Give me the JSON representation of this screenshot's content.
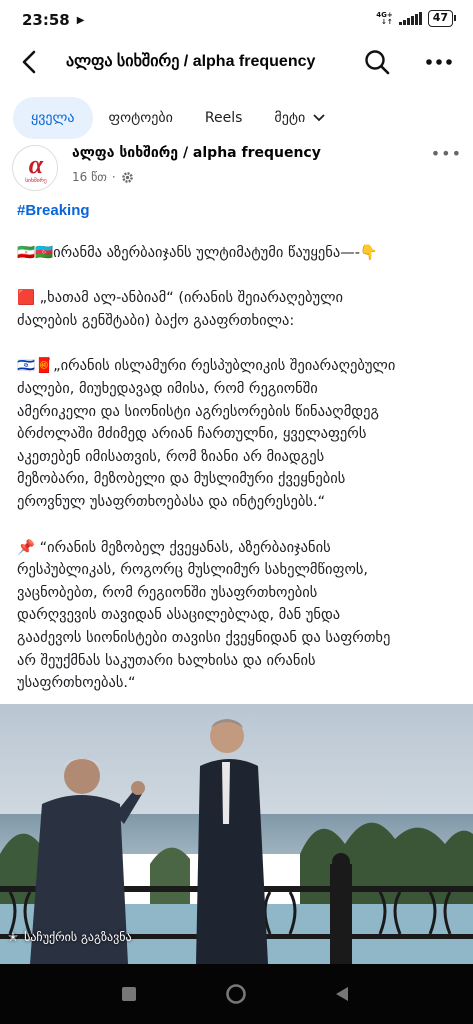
{
  "status_bar": {
    "time": "23:58",
    "network_top": "4G+",
    "network_bottom": "↓↑",
    "battery": "47"
  },
  "header": {
    "title": "ალფა სიხშირე / alpha frequency"
  },
  "tabs": [
    {
      "label": "ყველა"
    },
    {
      "label": "ფოტოები"
    },
    {
      "label": "Reels"
    },
    {
      "label": "მეტი"
    }
  ],
  "post": {
    "page_name": "ალფა სიხშირე / alpha frequency",
    "time": "16 წთ",
    "avatar_text": "სიხშირე",
    "hashtag": "#Breaking",
    "paragraphs": [
      "🇮🇷🇦🇿ირანმა აზერბაიჯანს ულტიმატუმი წაუყენა—-👇",
      "🟥 „ხათამ ალ-ანბიამ“ (ირანის შეიარაღებული\nძალების გენშტაბი) ბაქო გააფრთხილა:",
      "🇮🇱🧧„ირანის ისლამური რესპუბლიკის შეიარაღებული\nძალები, მიუხედავად იმისა, რომ რეგიონში\nამერიკელი და სიონისტი აგრესორების წინააღმდეგ\nბრძოლაში მძიმედ არიან ჩართულნი, ყველაფერს\nაკეთებენ იმისათვის, რომ ზიანი არ მიადგეს\nმეზობარი, მეზობელი და მუსლიმური ქვეყნების\nეროვნულ უსაფრთხოებასა და ინტერესებს.“",
      "📌 “ირანის მეზობელ ქვეყანას, აზერბაიჯანის\nრესპუბლიკას, როგორც მუსლიმურ სახელმწიფოს,\nვაცნობებთ, რომ რეგიონში უსაფრთხოების\nდარღვევის თავიდან ასაცილებლად, მან უნდა\nგააძევოს სიონისტები თავისი ქვეყნიდან და საფრთხე\nარ შეუქმნას საკუთარი ხალხისა და ირანის\nუსაფრთხოებას.“"
    ],
    "photo_label": "საჩუქრის გაგზავნა"
  },
  "colors": {
    "accent": "#0866d8",
    "tab_active_bg": "#e7f0fd",
    "text": "#1c1e21",
    "secondary": "#65676b",
    "navbar": "#050505"
  }
}
